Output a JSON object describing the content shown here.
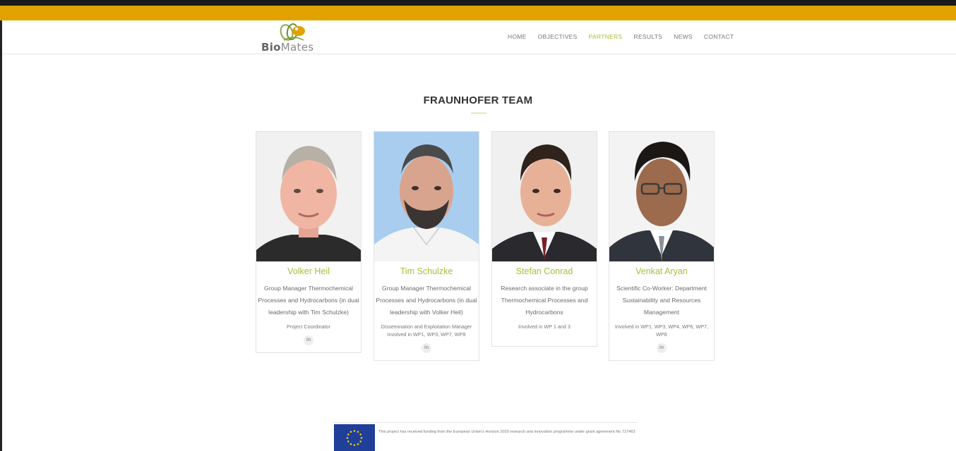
{
  "brand": {
    "logo_text_bold": "Bio",
    "logo_text_rest": "Mates"
  },
  "nav": {
    "items": [
      {
        "label": "HOME",
        "active": false
      },
      {
        "label": "OBJECTIVES",
        "active": false
      },
      {
        "label": "PARTNERS",
        "active": true
      },
      {
        "label": "RESULTS",
        "active": false
      },
      {
        "label": "NEWS",
        "active": false
      },
      {
        "label": "CONTACT",
        "active": false
      }
    ]
  },
  "colors": {
    "accent_bar": "#e1a200",
    "brand_green": "#a5c13a",
    "eu_blue": "#1f3f99"
  },
  "section": {
    "title": "FRAUNHOFER TEAM"
  },
  "team": [
    {
      "name": "Volker Heil",
      "role": "Group Manager Thermochemical Processes and Hydrocarbons (in dual leadership with Tim Schulzke)",
      "responsibility": "Project Coordinator",
      "linkedin": "in",
      "photo_icon": "person-photo"
    },
    {
      "name": "Tim Schulzke",
      "role": "Group Manager Thermochemical Processes and Hydrocarbons (in dual leadership with Volker Heil)",
      "responsibility": "Dissemination and Exploitation Manager Involved in WP1, WP3, WP7, WP8",
      "linkedin": "in",
      "photo_icon": "person-photo"
    },
    {
      "name": "Stefan Conrad",
      "role": "Research associate in the group Thermochemical Processes and Hydrocarbons",
      "responsibility": "Involved in WP 1 and 3",
      "linkedin": "",
      "photo_icon": "person-photo"
    },
    {
      "name": "Venkat Aryan",
      "role": "Scientific Co-Worker: Department Sustainability and Resources Management",
      "responsibility": "Involved in WP1, WP3, WP4, WP6, WP7, WP8",
      "linkedin": "in",
      "photo_icon": "person-photo"
    }
  ],
  "footer": {
    "funding_text": "This project has received funding from the European Union's Horizon 2020 research and innovation programme under grant agreement No 727463",
    "flag_icon": "eu-flag-icon"
  }
}
